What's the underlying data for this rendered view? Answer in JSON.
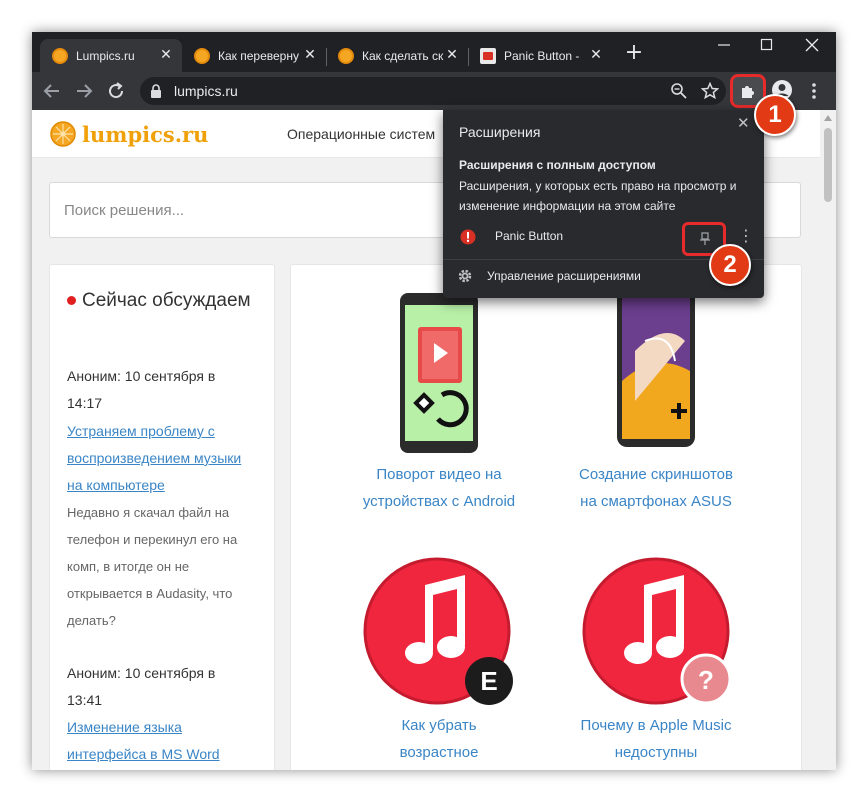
{
  "browser": {
    "tabs": [
      {
        "title": "Lumpics.ru",
        "favicon": "orange-logo-icon",
        "active": true
      },
      {
        "title": "Как переверну",
        "favicon": "orange-logo-icon",
        "active": false
      },
      {
        "title": "Как сделать ск",
        "favicon": "orange-logo-icon",
        "active": false
      },
      {
        "title": "Panic Button -",
        "favicon": "panic-button-icon",
        "active": false
      }
    ],
    "new_tab_icon": "plus-icon",
    "address": "lumpics.ru",
    "window_controls": [
      "minimize-icon",
      "maximize-icon",
      "close-icon"
    ]
  },
  "site": {
    "logo_text": "lumpics.ru",
    "nav_item": "Операционные систем",
    "search_placeholder": "Поиск решения...",
    "sidebar": {
      "heading": "Сейчас обсуждаем",
      "comments": [
        {
          "meta_line1": "Аноним: 10 сентября в",
          "meta_line2": "14:17",
          "link_lines": [
            "Устраняем проблему с",
            "воспроизведением музыки",
            "на компьютере"
          ],
          "text_lines": [
            "Недавно я скачал файл на",
            "телефон и перекинул его на",
            "комп, в итогде он не",
            "открывается в Audasity, что",
            "делать?"
          ]
        },
        {
          "meta_line1": "Аноним: 10 сентября в",
          "meta_line2": "13:41",
          "link_lines": [
            "Изменение языка",
            "интерфейса в MS Word"
          ],
          "text_lines": []
        }
      ]
    },
    "cards": [
      {
        "title_lines": [
          "Поворот видео на",
          "устройствах с Android"
        ]
      },
      {
        "title_lines": [
          "Создание скриншотов",
          "на смартфонах ASUS"
        ]
      },
      {
        "title_lines": [
          "Как убрать",
          "возрастное"
        ]
      },
      {
        "title_lines": [
          "Почему в Apple Music",
          "недоступны"
        ]
      }
    ]
  },
  "extensions_popup": {
    "title": "Расширения",
    "section_title": "Расширения с полным доступом",
    "section_desc": "Расширения, у которых есть право на просмотр и изменение информации на этом сайте",
    "extension_name": "Panic Button",
    "manage_label": "Управление расширениями"
  },
  "annotations": [
    "1",
    "2"
  ],
  "colors": {
    "highlight": "#e52b2b",
    "badge": "#e23a14",
    "link": "#3a85c6",
    "logo": "#f0a10a",
    "itunes_red": "#f0263e"
  }
}
